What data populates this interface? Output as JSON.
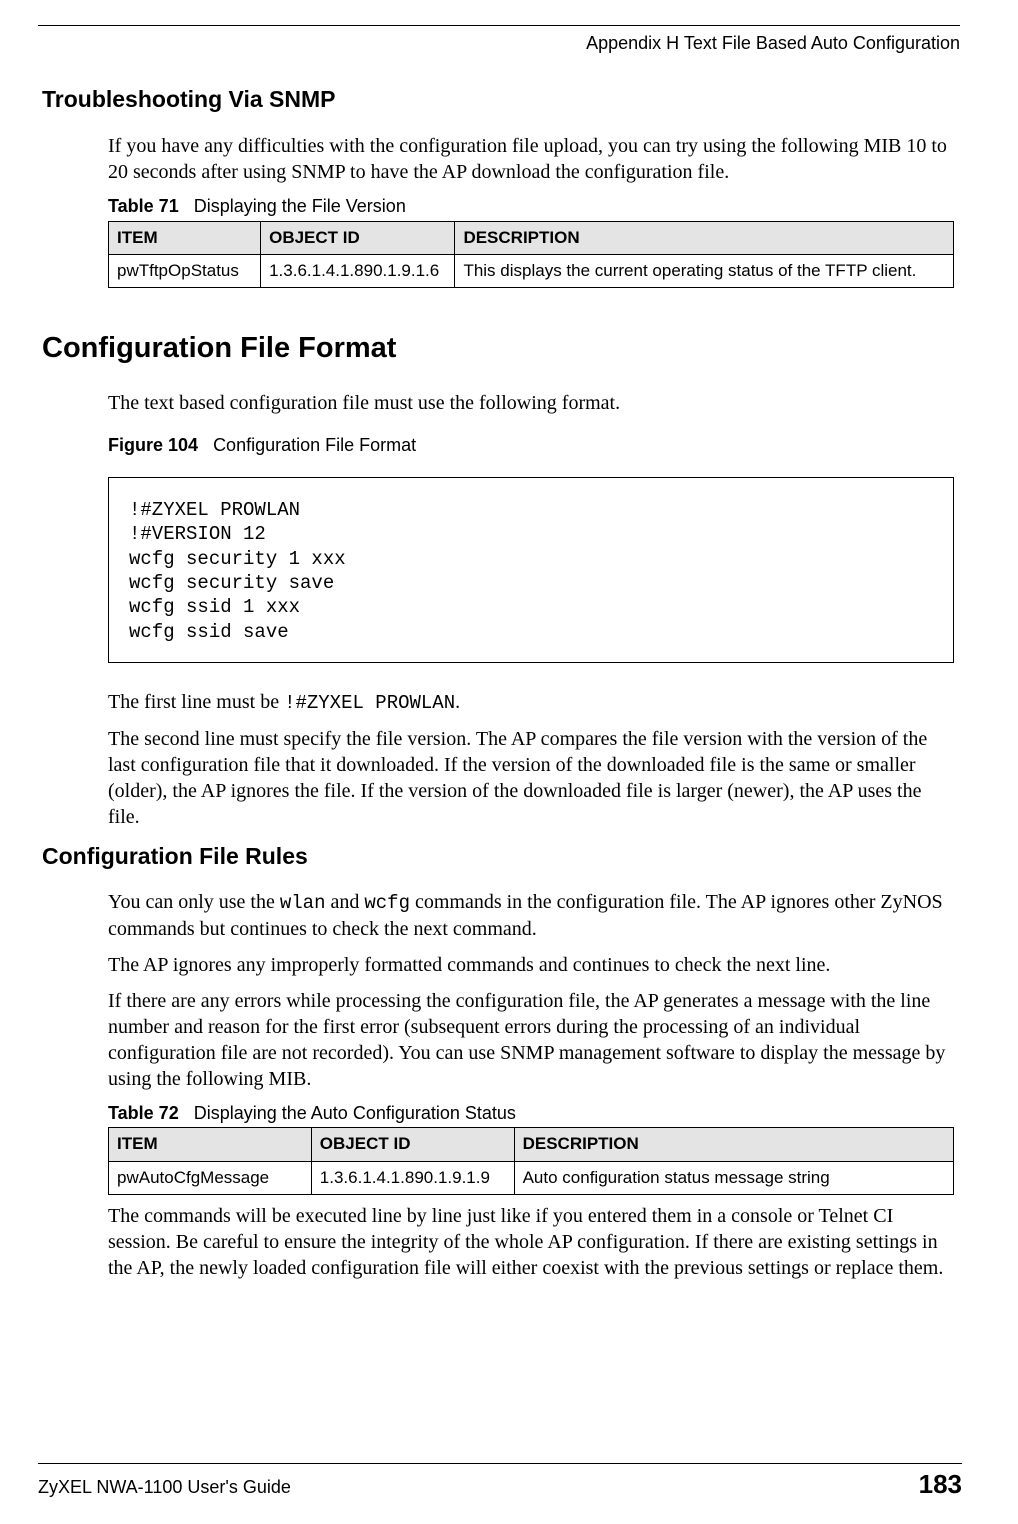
{
  "header": {
    "appendix": "Appendix H Text File Based Auto Configuration"
  },
  "sections": {
    "troubleshooting": {
      "heading": "Troubleshooting Via SNMP",
      "para1": "If you have any difficulties with the configuration file upload, you can try using the following MIB 10 to 20 seconds after using SNMP to have the AP download the configuration file."
    },
    "table71": {
      "caption_label": "Table 71",
      "caption_text": "Displaying the File Version",
      "headers": {
        "item": "ITEM",
        "objectid": "OBJECT ID",
        "description": "DESCRIPTION"
      },
      "rows": [
        {
          "item": "pwTftpOpStatus",
          "objectid": "1.3.6.1.4.1.890.1.9.1.6",
          "description": "This displays the current operating status of the TFTP client."
        }
      ]
    },
    "config_format": {
      "heading": "Configuration File Format",
      "para1": "The text based configuration file must use the following format.",
      "figure_label": "Figure 104",
      "figure_text": "Configuration File Format",
      "code": "!#ZYXEL PROWLAN\n!#VERSION 12\nwcfg security 1 xxx\nwcfg security save\nwcfg ssid 1 xxx\nwcfg ssid save",
      "para2_pre": "The first line must be ",
      "para2_code": "!#ZYXEL PROWLAN",
      "para2_post": ".",
      "para3": "The second line must specify the file version. The AP compares the file version with the version of the last configuration file that it downloaded. If the version of the downloaded file is the same or smaller (older), the AP ignores the file. If the version of the downloaded file is larger (newer), the AP uses the file."
    },
    "config_rules": {
      "heading": "Configuration File Rules",
      "para1_a": "You can only use the ",
      "para1_code1": "wlan",
      "para1_b": " and ",
      "para1_code2": "wcfg",
      "para1_c": " commands in the configuration file. The AP ignores other ZyNOS commands but continues to check the next command.",
      "para2": "The AP ignores any improperly formatted commands and continues to check the next line.",
      "para3": "If there are any errors while processing the configuration file, the AP generates a message with the line number and reason for the first error (subsequent errors during the processing of an individual configuration file are not recorded). You can use SNMP management software to display the message by using the following MIB."
    },
    "table72": {
      "caption_label": "Table 72",
      "caption_text": "Displaying the Auto Configuration Status",
      "headers": {
        "item": "ITEM",
        "objectid": "OBJECT ID",
        "description": "DESCRIPTION"
      },
      "rows": [
        {
          "item": "pwAutoCfgMessage",
          "objectid": "1.3.6.1.4.1.890.1.9.1.9",
          "description": "Auto configuration status message string"
        }
      ]
    },
    "after_table72": {
      "para1": "The commands will be executed line by line just like if you entered them in a console or Telnet CI session. Be careful to ensure the integrity of the whole AP configuration. If there are existing settings in the AP, the newly loaded configuration file will either coexist with the previous settings or replace them."
    }
  },
  "footer": {
    "guide": "ZyXEL NWA-1100 User's Guide",
    "page": "183"
  }
}
